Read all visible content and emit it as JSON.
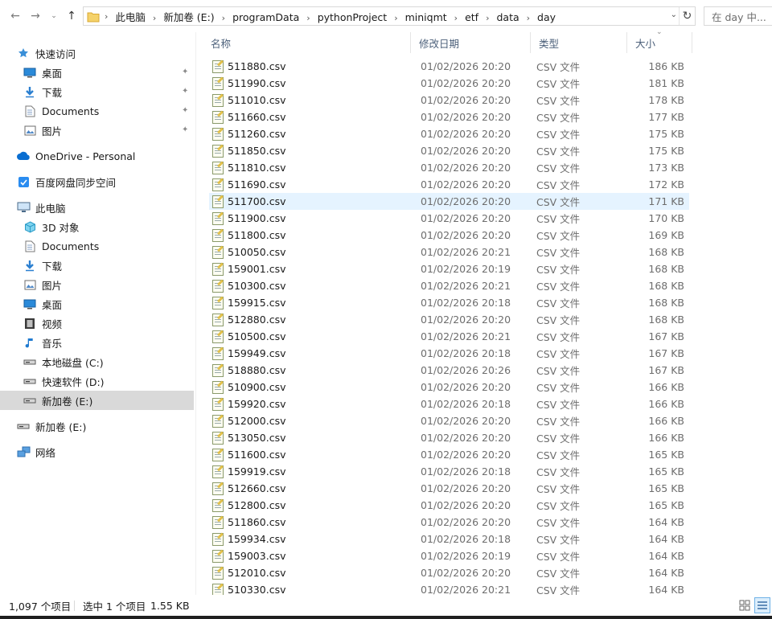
{
  "address": {
    "crumbs": [
      "此电脑",
      "新加卷 (E:)",
      "programData",
      "pythonProject",
      "miniqmt",
      "etf",
      "data",
      "day"
    ]
  },
  "search": {
    "placeholder": "在 day 中..."
  },
  "sidebar": {
    "items": [
      {
        "label": "快速访问",
        "icon": "star-icon",
        "indent": 1
      },
      {
        "label": "桌面",
        "icon": "desktop-icon",
        "indent": 2,
        "pinned": true
      },
      {
        "label": "下载",
        "icon": "download-icon",
        "indent": 2,
        "pinned": true
      },
      {
        "label": "Documents",
        "icon": "document-icon",
        "indent": 2,
        "pinned": true
      },
      {
        "label": "图片",
        "icon": "picture-icon",
        "indent": 2,
        "pinned": true
      },
      {
        "label": "OneDrive - Personal",
        "icon": "cloud-icon",
        "indent": 1
      },
      {
        "label": "百度网盘同步空间",
        "icon": "sync-icon",
        "indent": 1
      },
      {
        "label": "此电脑",
        "icon": "computer-icon",
        "indent": 1
      },
      {
        "label": "3D 对象",
        "icon": "cube-icon",
        "indent": 2
      },
      {
        "label": "Documents",
        "icon": "document-icon",
        "indent": 2
      },
      {
        "label": "下载",
        "icon": "download-icon",
        "indent": 2
      },
      {
        "label": "图片",
        "icon": "picture-icon",
        "indent": 2
      },
      {
        "label": "桌面",
        "icon": "desktop-icon",
        "indent": 2
      },
      {
        "label": "视频",
        "icon": "video-icon",
        "indent": 2
      },
      {
        "label": "音乐",
        "icon": "music-icon",
        "indent": 2
      },
      {
        "label": "本地磁盘 (C:)",
        "icon": "drive-icon",
        "indent": 2
      },
      {
        "label": "快速软件 (D:)",
        "icon": "drive-icon",
        "indent": 2
      },
      {
        "label": "新加卷 (E:)",
        "icon": "drive-icon",
        "indent": 2,
        "selected": true
      },
      {
        "label": "新加卷 (E:)",
        "icon": "drive-icon",
        "indent": 1
      },
      {
        "label": "网络",
        "icon": "network-icon",
        "indent": 1
      }
    ]
  },
  "columns": {
    "name": "名称",
    "date": "修改日期",
    "type": "类型",
    "size": "大小"
  },
  "files": [
    {
      "name": "511880.csv",
      "date": "01/02/2026 20:20",
      "type": "CSV 文件",
      "size": "186 KB"
    },
    {
      "name": "511990.csv",
      "date": "01/02/2026 20:20",
      "type": "CSV 文件",
      "size": "181 KB"
    },
    {
      "name": "511010.csv",
      "date": "01/02/2026 20:20",
      "type": "CSV 文件",
      "size": "178 KB"
    },
    {
      "name": "511660.csv",
      "date": "01/02/2026 20:20",
      "type": "CSV 文件",
      "size": "177 KB"
    },
    {
      "name": "511260.csv",
      "date": "01/02/2026 20:20",
      "type": "CSV 文件",
      "size": "175 KB"
    },
    {
      "name": "511850.csv",
      "date": "01/02/2026 20:20",
      "type": "CSV 文件",
      "size": "175 KB"
    },
    {
      "name": "511810.csv",
      "date": "01/02/2026 20:20",
      "type": "CSV 文件",
      "size": "173 KB"
    },
    {
      "name": "511690.csv",
      "date": "01/02/2026 20:20",
      "type": "CSV 文件",
      "size": "172 KB"
    },
    {
      "name": "511700.csv",
      "date": "01/02/2026 20:20",
      "type": "CSV 文件",
      "size": "171 KB",
      "hover": true
    },
    {
      "name": "511900.csv",
      "date": "01/02/2026 20:20",
      "type": "CSV 文件",
      "size": "170 KB"
    },
    {
      "name": "511800.csv",
      "date": "01/02/2026 20:20",
      "type": "CSV 文件",
      "size": "169 KB"
    },
    {
      "name": "510050.csv",
      "date": "01/02/2026 20:21",
      "type": "CSV 文件",
      "size": "168 KB"
    },
    {
      "name": "159001.csv",
      "date": "01/02/2026 20:19",
      "type": "CSV 文件",
      "size": "168 KB"
    },
    {
      "name": "510300.csv",
      "date": "01/02/2026 20:21",
      "type": "CSV 文件",
      "size": "168 KB"
    },
    {
      "name": "159915.csv",
      "date": "01/02/2026 20:18",
      "type": "CSV 文件",
      "size": "168 KB"
    },
    {
      "name": "512880.csv",
      "date": "01/02/2026 20:20",
      "type": "CSV 文件",
      "size": "168 KB"
    },
    {
      "name": "510500.csv",
      "date": "01/02/2026 20:21",
      "type": "CSV 文件",
      "size": "167 KB"
    },
    {
      "name": "159949.csv",
      "date": "01/02/2026 20:18",
      "type": "CSV 文件",
      "size": "167 KB"
    },
    {
      "name": "518880.csv",
      "date": "01/02/2026 20:26",
      "type": "CSV 文件",
      "size": "167 KB"
    },
    {
      "name": "510900.csv",
      "date": "01/02/2026 20:20",
      "type": "CSV 文件",
      "size": "166 KB"
    },
    {
      "name": "159920.csv",
      "date": "01/02/2026 20:18",
      "type": "CSV 文件",
      "size": "166 KB"
    },
    {
      "name": "512000.csv",
      "date": "01/02/2026 20:20",
      "type": "CSV 文件",
      "size": "166 KB"
    },
    {
      "name": "513050.csv",
      "date": "01/02/2026 20:20",
      "type": "CSV 文件",
      "size": "166 KB"
    },
    {
      "name": "511600.csv",
      "date": "01/02/2026 20:20",
      "type": "CSV 文件",
      "size": "165 KB"
    },
    {
      "name": "159919.csv",
      "date": "01/02/2026 20:18",
      "type": "CSV 文件",
      "size": "165 KB"
    },
    {
      "name": "512660.csv",
      "date": "01/02/2026 20:20",
      "type": "CSV 文件",
      "size": "165 KB"
    },
    {
      "name": "512800.csv",
      "date": "01/02/2026 20:20",
      "type": "CSV 文件",
      "size": "165 KB"
    },
    {
      "name": "511860.csv",
      "date": "01/02/2026 20:20",
      "type": "CSV 文件",
      "size": "164 KB"
    },
    {
      "name": "159934.csv",
      "date": "01/02/2026 20:18",
      "type": "CSV 文件",
      "size": "164 KB"
    },
    {
      "name": "159003.csv",
      "date": "01/02/2026 20:19",
      "type": "CSV 文件",
      "size": "164 KB"
    },
    {
      "name": "512010.csv",
      "date": "01/02/2026 20:20",
      "type": "CSV 文件",
      "size": "164 KB"
    },
    {
      "name": "510330.csv",
      "date": "01/02/2026 20:21",
      "type": "CSV 文件",
      "size": "164 KB"
    }
  ],
  "status": {
    "item_count": "1,097 个项目",
    "selected": "选中 1 个项目",
    "selected_size": "1.55 KB"
  },
  "colors": {
    "accent": "#0078d7",
    "hover_row": "#e5f3ff",
    "selected_nav": "#d9d9d9",
    "header_text": "#4c607a"
  }
}
